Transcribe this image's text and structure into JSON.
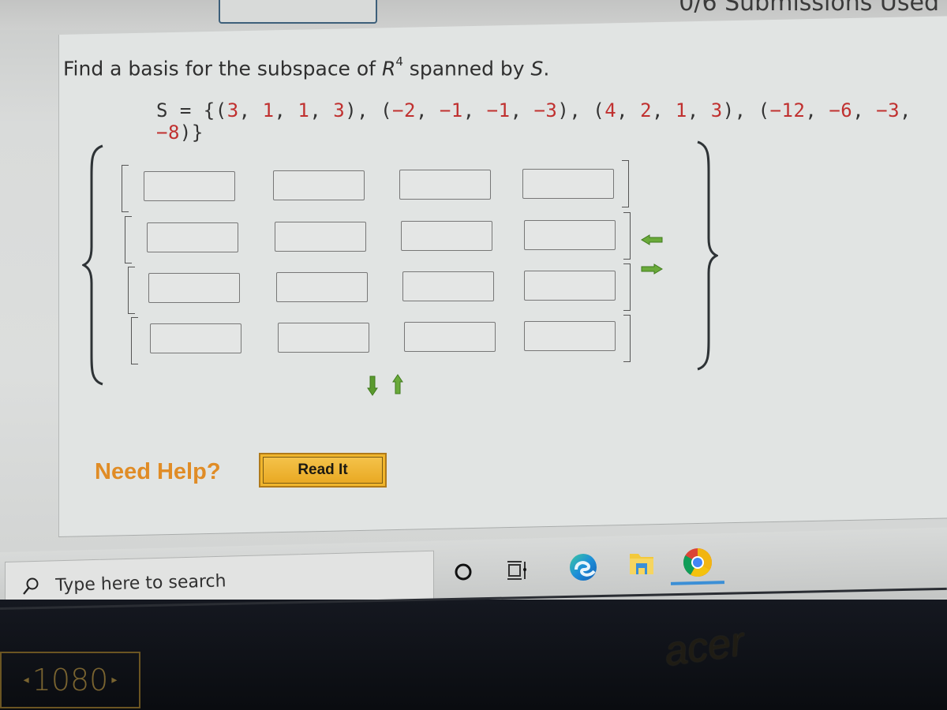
{
  "header": {
    "submissions_text": "0/6 Submissions Used"
  },
  "question": {
    "prompt_before": "Find a basis for the subspace of ",
    "space_symbol": "R",
    "space_exponent": "4",
    "prompt_after": " spanned by ",
    "set_symbol": "S",
    "prompt_end": ".",
    "set_prefix": "S = {",
    "set_suffix": "}",
    "vectors": [
      [
        3,
        1,
        1,
        3
      ],
      [
        -2,
        -1,
        -1,
        -3
      ],
      [
        4,
        2,
        1,
        3
      ],
      [
        -12,
        -6,
        -3,
        -8
      ]
    ],
    "vector_color": "#c0302f"
  },
  "answer_grid": {
    "rows": 4,
    "cols": 4,
    "values": [
      [
        "",
        "",
        "",
        ""
      ],
      [
        "",
        "",
        "",
        ""
      ],
      [
        "",
        "",
        "",
        ""
      ],
      [
        "",
        "",
        "",
        ""
      ]
    ],
    "controls": {
      "remove_row": "down-arrow",
      "add_row": "up-arrow",
      "remove_col": "left-arrow",
      "add_col": "right-arrow",
      "color": "#5a9a2e"
    }
  },
  "help": {
    "label": "Need Help?",
    "read_it_label": "Read It",
    "label_color": "#e08c26",
    "button_color": "#f0b52c"
  },
  "taskbar": {
    "search_placeholder": "Type here to search",
    "icons": [
      "cortana-icon",
      "task-view-icon",
      "edge-icon",
      "file-explorer-icon",
      "chrome-icon"
    ],
    "active_app": "chrome-icon"
  },
  "monitor": {
    "badge": "1080",
    "brand": "acer"
  }
}
